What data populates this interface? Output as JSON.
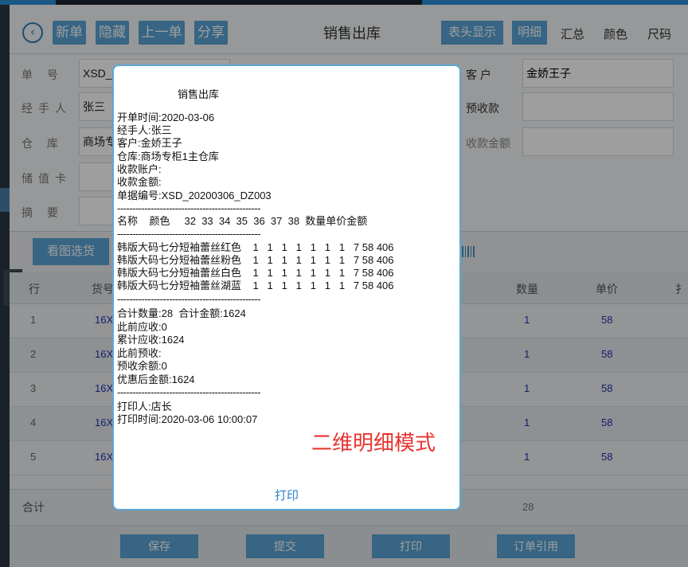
{
  "app": {
    "header": {
      "title": "销售出库",
      "buttons": [
        "新单",
        "隐藏",
        "上一单",
        "分享"
      ],
      "header_display": "表头显示",
      "detail": "明细",
      "summary": "汇总",
      "color": "颜色",
      "size": "尺码"
    },
    "form": {
      "order_no_label": "单 号",
      "order_no_value": "XSD_2",
      "handler_label": "经手人",
      "handler_value": "张三",
      "warehouse_label": "仓 库",
      "warehouse_value": "商场专",
      "stored_card_label": "储值卡",
      "remark_label": "摘 要",
      "customer_label": "客 户",
      "customer_value": "金娇王子",
      "prepaid_label": "预收款",
      "received_label": "收款金额"
    },
    "toolbar": {
      "pick_button": "看图选货"
    },
    "table": {
      "headers": {
        "row": "行",
        "code": "货号",
        "qty": "数量",
        "price": "单价",
        "more": "扌"
      },
      "rows": [
        {
          "idx": "1",
          "code": "16X",
          "qty": "1",
          "price": "58"
        },
        {
          "idx": "2",
          "code": "16X",
          "qty": "1",
          "price": "58"
        },
        {
          "idx": "3",
          "code": "16X",
          "qty": "1",
          "price": "58"
        },
        {
          "idx": "4",
          "code": "16X",
          "qty": "1",
          "price": "58"
        },
        {
          "idx": "5",
          "code": "16X",
          "qty": "1",
          "price": "58"
        }
      ],
      "total_label": "合计",
      "total_qty": "28"
    },
    "bottom": {
      "save": "保存",
      "submit": "提交",
      "print": "打印",
      "order_ref": "订单引用"
    }
  },
  "dialog": {
    "title": "销售出库",
    "lines_header": [
      "开单时间:2020-03-06",
      "经手人:张三",
      "客户:金娇王子",
      "仓库:商场专柜1主仓库",
      "收款账户:",
      "收款金额:",
      "单据编号:XSD_20200306_DZ003"
    ],
    "dash": "-----------------------------------------------",
    "column_header": "名称    颜色     32  33  34  35  36  37  38  数量单价金额",
    "items": [
      "韩版大码七分短袖蕾丝红色    1   1   1   1   1   1   1   7 58 406",
      "韩版大码七分短袖蕾丝粉色    1   1   1   1   1   1   1   7 58 406",
      "韩版大码七分短袖蕾丝白色    1   1   1   1   1   1   1   7 58 406",
      "韩版大码七分短袖蕾丝湖蓝    1   1   1   1   1   1   1   7 58 406"
    ],
    "totals": [
      "合计数量:28  合计金额:1624",
      "此前应收:0",
      "累计应收:1624",
      "此前预收:",
      "预收余额:0",
      "优惠后金额:1624"
    ],
    "footer": [
      "打印人:店长",
      "打印时间:2020-03-06 10:00:07"
    ],
    "caption": "二维明细模式",
    "print_action": "打印"
  },
  "colors": {
    "accent": "#5aa3d3",
    "caption_red": "#e8332e",
    "link_blue": "#2a7fd0"
  }
}
